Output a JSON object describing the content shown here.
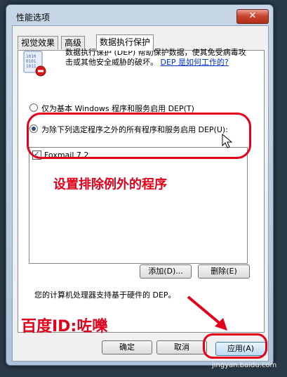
{
  "window": {
    "title": "性能选项",
    "close_symbol": "✕"
  },
  "tabs": [
    {
      "label": "视觉效果",
      "active": false
    },
    {
      "label": "高级",
      "active": false
    },
    {
      "label": "数据执行保护",
      "active": true
    }
  ],
  "description": {
    "text": "数据执行保护 (DEP) 帮助保护数据，使其免受病毒攻击或其他安全威胁的破坏。",
    "link": "DEP 是如何工作的?"
  },
  "options": [
    {
      "label": "仅为基本 Windows 程序和服务启用 DEP(T)",
      "checked": false
    },
    {
      "label": "为除下列选定程序之外的所有程序和服务启用 DEP(U):",
      "checked": true
    }
  ],
  "program_list": [
    {
      "name": "Foxmail 7.2",
      "checked": true
    }
  ],
  "buttons": {
    "add": "添加(D)...",
    "remove": "删除(E)",
    "ok": "确定",
    "cancel": "取消",
    "apply": "应用(A)"
  },
  "hardware_note": "您的计算机处理器支持基于硬件的 DEP。",
  "annotations": {
    "caption": "设置排除例外的程序",
    "watermark": "百度ID:咗嚛",
    "site": "jingyan.baidu.com",
    "color": "#e3001b"
  }
}
